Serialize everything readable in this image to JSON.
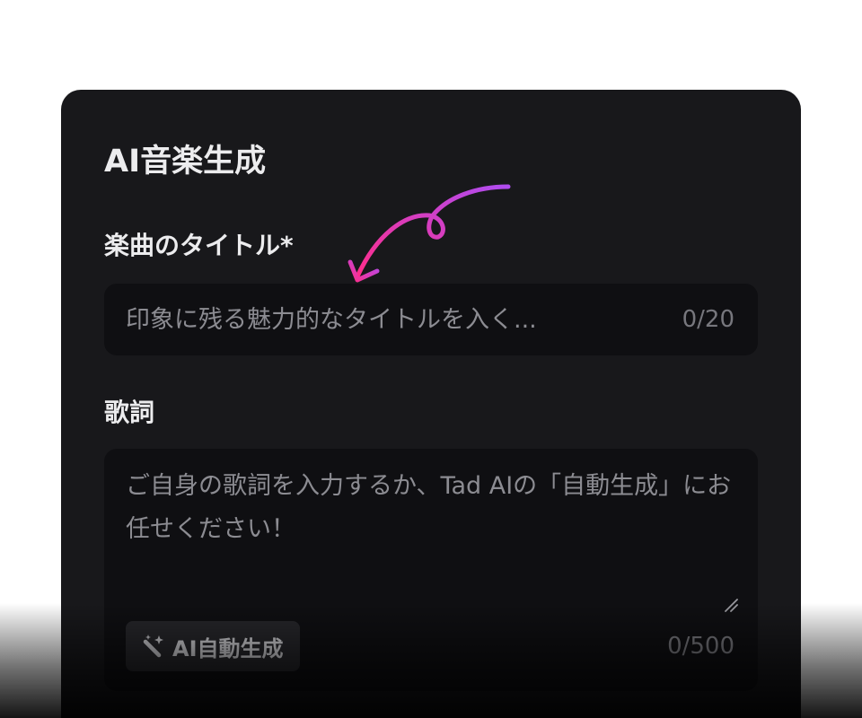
{
  "panel": {
    "title": "AI音楽生成"
  },
  "song_title": {
    "label": "楽曲のタイトル*",
    "placeholder": "印象に残る魅力的なタイトルを入く...",
    "value": "",
    "counter": "0/20"
  },
  "lyrics": {
    "label": "歌詞",
    "placeholder": "ご自身の歌詞を入力するか、Tad AIの「自動生成」にお任せください！",
    "value": "",
    "counter": "0/500",
    "ai_button_label": "AI自動生成",
    "ai_button_icon": "magic-wand-icon"
  },
  "annotation": {
    "arrow_icon": "curly-arrow-icon",
    "gradient_start": "#b04cf0",
    "gradient_end": "#ff2d8a"
  },
  "colors": {
    "page_background": "#ffffff",
    "panel_background": "#18181b",
    "input_background": "#0f0f12",
    "button_background": "#26262a",
    "text_primary": "#ececee",
    "text_placeholder": "#8c8c92"
  }
}
